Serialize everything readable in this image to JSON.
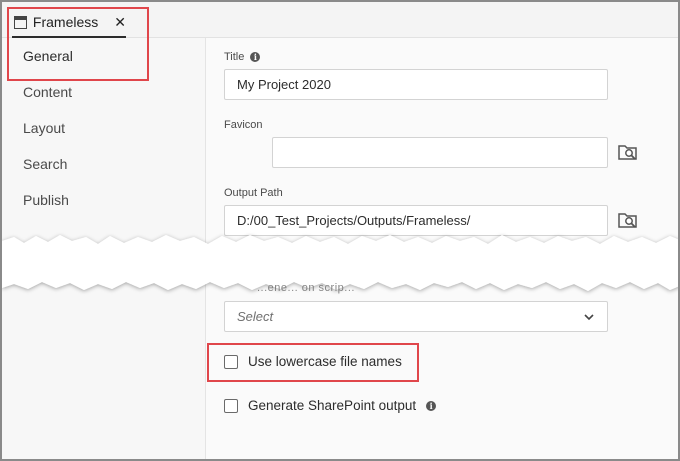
{
  "tab": {
    "title": "Frameless",
    "close_glyph": "✕",
    "icon": "window-icon"
  },
  "sidebar": {
    "items": [
      {
        "label": "General",
        "active": true
      },
      {
        "label": "Content"
      },
      {
        "label": "Layout"
      },
      {
        "label": "Search"
      },
      {
        "label": "Publish"
      }
    ]
  },
  "fields": {
    "title": {
      "label": "Title",
      "value": "My Project 2020"
    },
    "favicon": {
      "label": "Favicon",
      "value": ""
    },
    "output_path": {
      "label": "Output Path",
      "value": "D:/00_Test_Projects/Outputs/Frameless/"
    }
  },
  "partial_label": "...ene... on scrip...",
  "select": {
    "placeholder": "Select"
  },
  "checkboxes": {
    "lowercase": {
      "label": "Use lowercase file names",
      "checked": false
    },
    "sharepoint": {
      "label": "Generate SharePoint output",
      "checked": false
    }
  },
  "colors": {
    "highlight": "#e0464b",
    "border": "#d3d3d3",
    "background": "#fafafa"
  }
}
